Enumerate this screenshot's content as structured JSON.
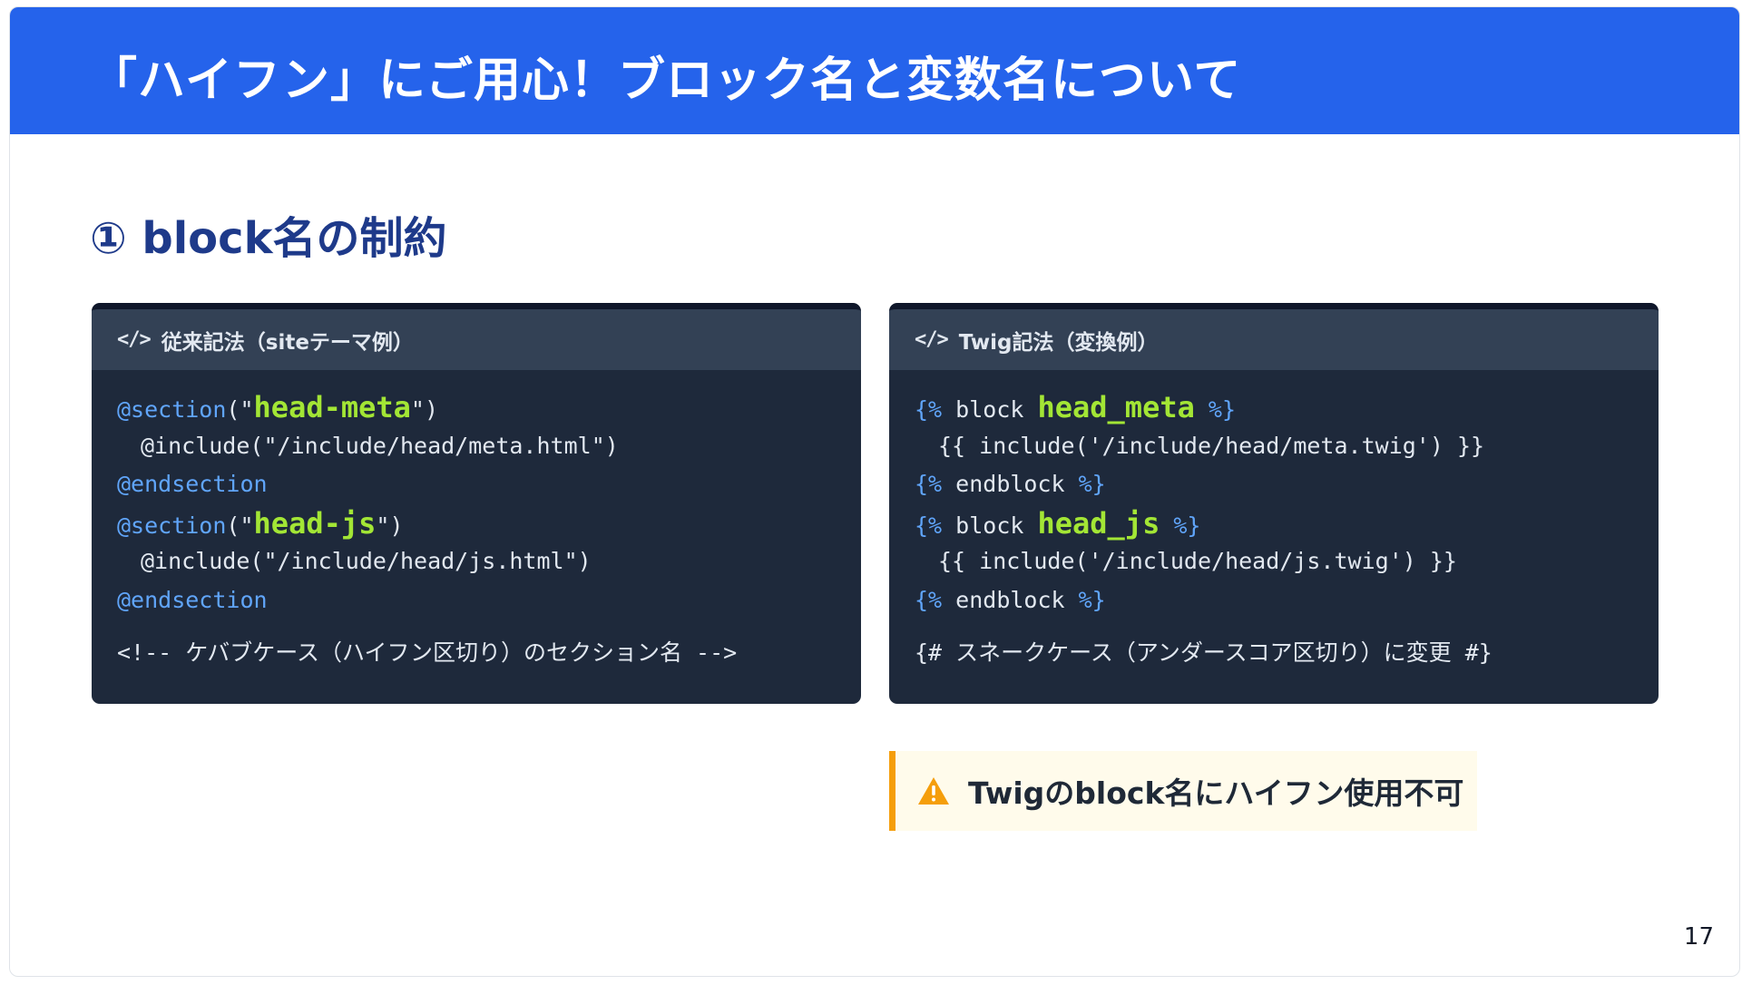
{
  "slide": {
    "title": "「ハイフン」にご用心！ブロック名と変数名について",
    "section_heading": "① block名の制約",
    "page_number": "17"
  },
  "left_card": {
    "header_label": "従来記法（siteテーマ例）",
    "icon": "code-icon",
    "lines": {
      "l1_kw": "@section",
      "l1_open": "(\"",
      "l1_name": "head-meta",
      "l1_close": "\")",
      "l2": "@include(\"/include/head/meta.html\")",
      "l3_kw": "@endsection",
      "l4_kw": "@section",
      "l4_open": "(\"",
      "l4_name": "head-js",
      "l4_close": "\")",
      "l5": "@include(\"/include/head/js.html\")",
      "l6_kw": "@endsection",
      "comment": "<!-- ケバブケース（ハイフン区切り）のセクション名 -->"
    }
  },
  "right_card": {
    "header_label": "Twig記法（変換例）",
    "icon": "code-icon",
    "lines": {
      "l1_open": "{%",
      "l1_word": " block ",
      "l1_name": "head_meta",
      "l1_close": " %}",
      "l2": "{{ include('/include/head/meta.twig') }}",
      "l3_open": "{%",
      "l3_word": " endblock ",
      "l3_close": "%}",
      "l4_open": "{%",
      "l4_word": " block ",
      "l4_name": "head_js",
      "l4_close": " %}",
      "l5": "{{ include('/include/head/js.twig') }}",
      "l6_open": "{%",
      "l6_word": " endblock ",
      "l6_close": "%}",
      "comment": "{# スネークケース（アンダースコア区切り）に変更 #}"
    }
  },
  "warning": {
    "icon": "warning-icon",
    "text": "Twigのblock名にハイフン使用不可"
  },
  "colors": {
    "header_bg": "#2563eb",
    "heading": "#1e3a8a",
    "code_bg": "#1e293b",
    "code_header_bg": "#334155",
    "keyword": "#60a5fa",
    "highlight": "#a3e635",
    "warning_accent": "#f59e0b",
    "warning_bg": "#fffbeb"
  }
}
